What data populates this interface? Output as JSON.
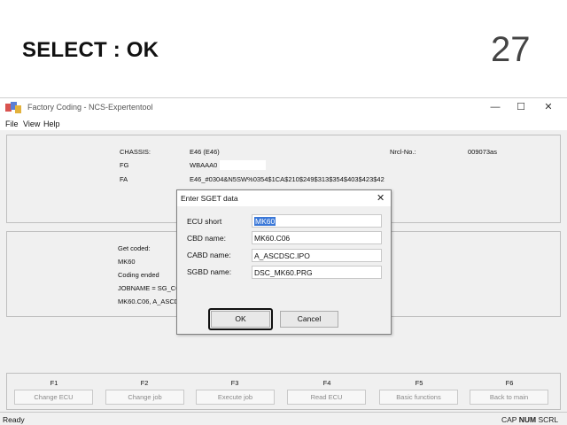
{
  "slide": {
    "title": "SELECT : OK",
    "number": "27"
  },
  "window": {
    "title": "Factory Coding - NCS-Expertentool",
    "controls": {
      "minimize": "—",
      "maximize": "☐",
      "close": "✕"
    }
  },
  "menu": {
    "file": "File",
    "view": "View",
    "help": "Help"
  },
  "vehicle": {
    "chassis_label": "CHASSIS:",
    "chassis_value": "E46 (E46)",
    "fg_label": "FG",
    "fg_value": "WBAAA0",
    "fa_label": "FA",
    "fa_value": "E46_#0304&N5SW%0354$1CA$210$249$313$354$403$423$42",
    "nrcl_label": "Nrcl-No.:",
    "nrcl_value": "009073as"
  },
  "status_panel": {
    "line1": "Get coded:",
    "line2": "MK60",
    "line3": "Coding ended",
    "line4": "JOBNAME = SG_CO",
    "line5": "MK60.C06, A_ASCD"
  },
  "fkeys": [
    {
      "key": "F1",
      "label": "Change ECU"
    },
    {
      "key": "F2",
      "label": "Change job"
    },
    {
      "key": "F3",
      "label": "Execute job"
    },
    {
      "key": "F4",
      "label": "Read ECU"
    },
    {
      "key": "F5",
      "label": "Basic functions"
    },
    {
      "key": "F6",
      "label": "Back to main"
    }
  ],
  "statusbar": {
    "left": "Ready",
    "cap": "CAP",
    "num": "NUM",
    "scrl": "SCRL"
  },
  "dialog": {
    "title": "Enter SGET data",
    "close": "✕",
    "ecu_short_label": "ECU short",
    "ecu_short_value": "MK60",
    "cbd_label": "CBD name:",
    "cbd_value": "MK60.C06",
    "cabd_label": "CABD name:",
    "cabd_value": "A_ASCDSC.IPO",
    "sgbd_label": "SGBD name:",
    "sgbd_value": "DSC_MK60.PRG",
    "ok_label": "OK",
    "cancel_label": "Cancel"
  },
  "colors": {
    "selection": "#3b78d8",
    "highlight_border": "#111111"
  }
}
